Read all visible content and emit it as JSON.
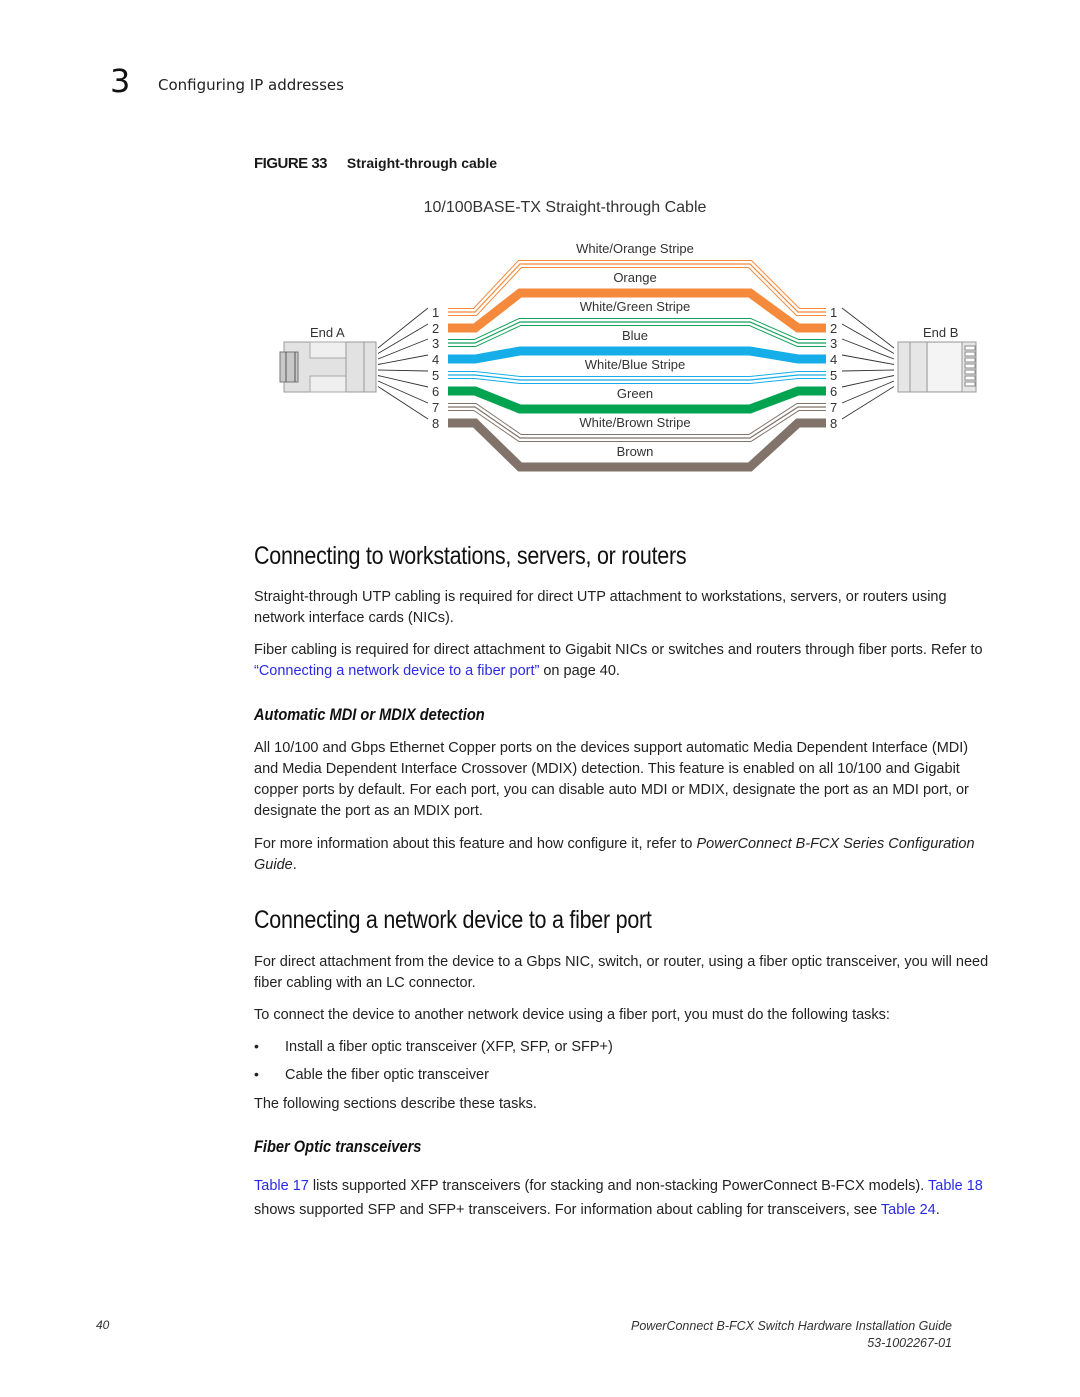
{
  "header": {
    "chapter_number": "3",
    "chapter_title": "Configuring IP addresses"
  },
  "figure": {
    "label": "FIGURE 33",
    "caption": "Straight-through cable",
    "diagram_title": "10/100BASE-TX Straight-through Cable",
    "end_a_label": "End A",
    "end_b_label": "End B",
    "pins": [
      "1",
      "2",
      "3",
      "4",
      "5",
      "6",
      "7",
      "8"
    ],
    "wires": [
      {
        "label": "White/Orange Stripe",
        "pin": "1",
        "color": "#f58a3c",
        "striped": true
      },
      {
        "label": "Orange",
        "pin": "2",
        "color": "#f58a3c",
        "striped": false
      },
      {
        "label": "White/Green Stripe",
        "pin": "3",
        "color": "#16a05a",
        "striped": true
      },
      {
        "label": "Blue",
        "pin": "4",
        "color": "#16aee8",
        "striped": false
      },
      {
        "label": "White/Blue Stripe",
        "pin": "5",
        "color": "#16aee8",
        "striped": true
      },
      {
        "label": "Green",
        "pin": "6",
        "color": "#00a34f",
        "striped": false
      },
      {
        "label": "White/Brown Stripe",
        "pin": "7",
        "color": "#82736a",
        "striped": true
      },
      {
        "label": "Brown",
        "pin": "8",
        "color": "#82736a",
        "striped": false
      }
    ]
  },
  "sections": {
    "workstations": {
      "heading": "Connecting to workstations, servers, or routers",
      "para1": "Straight-through UTP cabling is required for direct UTP attachment to workstations, servers, or routers using network interface cards (NICs).",
      "para2_before": "Fiber cabling is required for direct attachment to Gigabit NICs or switches and routers through fiber ports. Refer to ",
      "para2_link": "“Connecting a network device to a fiber port”",
      "para2_after": " on page 40."
    },
    "mdi": {
      "heading": "Automatic MDI or MDIX detection",
      "para1": "All 10/100 and Gbps Ethernet Copper ports on the devices support automatic Media Dependent Interface (MDI) and Media Dependent Interface Crossover (MDIX) detection. This feature is enabled on all 10/100 and Gigabit copper ports by default. For each port, you can disable auto MDI or MDIX, designate the port as an MDI port, or designate the port as an MDIX port.",
      "para2_before": "For more information about this feature and how configure it, refer to ",
      "para2_italic": "PowerConnect B-FCX Series Configuration Guide",
      "para2_after": "."
    },
    "fiber": {
      "heading": "Connecting a network device to a fiber port",
      "para1": "For direct attachment from the device to a Gbps NIC, switch, or router, using a fiber optic transceiver, you will need fiber cabling with an LC connector.",
      "para2": "To connect the device to another network device using a fiber port, you must do the following tasks:",
      "bullets": [
        "Install a fiber optic transceiver (XFP, SFP, or SFP+)",
        "Cable the fiber optic transceiver"
      ],
      "para3": "The following sections describe these tasks."
    },
    "transceivers": {
      "heading": "Fiber Optic transceivers",
      "link1": "Table 17",
      "text1": " lists supported XFP transceivers (for stacking and non-stacking PowerConnect B-FCX models). ",
      "link2": "Table 18",
      "text2": " shows supported SFP and SFP+ transceivers. For information about cabling for transceivers, see ",
      "link3": "Table 24",
      "text3": "."
    }
  },
  "footer": {
    "page_number": "40",
    "guide_title": "PowerConnect B-FCX Switch Hardware Installation Guide",
    "doc_number": "53-1002267-01"
  }
}
